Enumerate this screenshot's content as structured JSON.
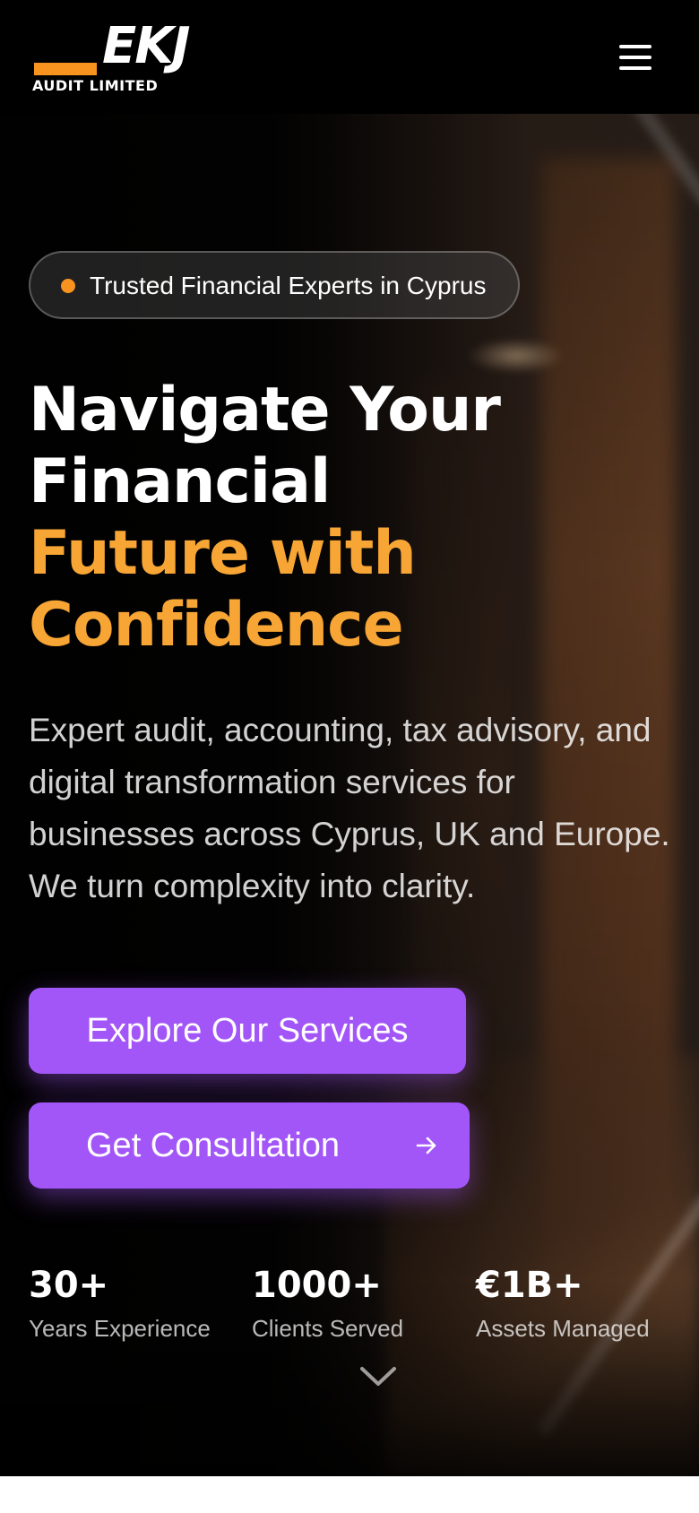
{
  "header": {
    "logo_letters": "EKJ",
    "logo_subtitle": "AUDIT LIMITED",
    "menu_icon": "hamburger-menu-icon"
  },
  "hero": {
    "badge_text": "Trusted Financial Experts in Cyprus",
    "headline_line1": "Navigate Your",
    "headline_line2": "Financial",
    "headline_accent_line1": "Future with",
    "headline_accent_line2": "Confidence",
    "description": "Expert audit, accounting, tax advisory, and digital transformation services for businesses across Cyprus, UK and Europe. We turn complexity into clarity.",
    "primary_button_label": "Explore Our Services",
    "secondary_button_label": "Get Consultation",
    "secondary_button_icon": "arrow-right-icon",
    "scroll_icon": "chevron-down-icon"
  },
  "stats": [
    {
      "value": "30+",
      "label": "Years Experience"
    },
    {
      "value": "1000+",
      "label": "Clients Served"
    },
    {
      "value": "€1B+",
      "label": "Assets Managed"
    }
  ],
  "colors": {
    "accent_orange": "#f7a534",
    "button_purple": "#a356f8",
    "header_bg": "#000000"
  }
}
